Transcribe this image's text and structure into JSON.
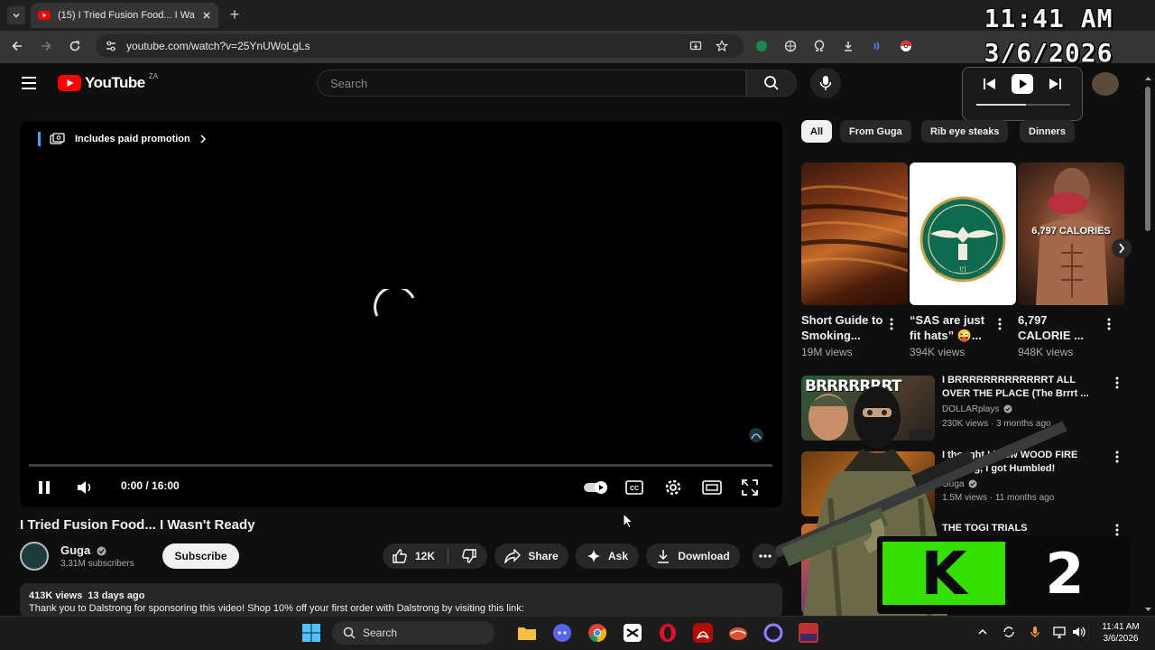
{
  "browser": {
    "tab_title": "(15) I Tried Fusion Food... I Wasn't Ready",
    "url": "youtube.com/watch?v=25YnUWoLgLs",
    "new_tab_symbol": "+"
  },
  "overlay_clock": {
    "time": "11:41 AM",
    "date": "3/6/2026"
  },
  "youtube": {
    "logo_text": "YouTube",
    "region": "ZA",
    "search_placeholder": "Search"
  },
  "player": {
    "paid_promotion": "Includes paid promotion",
    "time_display": "0:00 / 16:00",
    "progress_fraction": 0.0
  },
  "video": {
    "title": "I Tried Fusion Food... I Wasn't Ready",
    "channel": "Guga",
    "subscribers": "3.31M subscribers",
    "subscribe_label": "Subscribe",
    "likes": "12K",
    "share_label": "Share",
    "ask_label": "Ask",
    "download_label": "Download",
    "stats": "413K views  13 days ago",
    "description": "Thank you to Dalstrong for sponsoring this video! Shop 10% off your first order with Dalstrong by visiting this link:"
  },
  "chips": [
    "All",
    "From Guga",
    "Rib eye steaks",
    "Dinners"
  ],
  "shorts": [
    {
      "title": "Short Guide to Smoking...",
      "views": "19M views"
    },
    {
      "title": "“SAS are just fit hats” 😜...",
      "views": "394K views",
      "thumb_text": "section commander"
    },
    {
      "title": "6,797 CALORIE ...",
      "views": "948K views",
      "thumb_text": "6,797 CALORIES"
    }
  ],
  "related": [
    {
      "title": "I BRRRRRRRRRRRRRT ALL OVER THE PLACE (The Brrrt ...",
      "channel": "DOLLARplays",
      "meta": "230K views · 3 months ago",
      "thumb_text": "BRRRRRRRT"
    },
    {
      "title": "I thought I knew WOOD FIRE cooking, I got Humbled!",
      "channel": "Guga",
      "meta": "1.5M views · 11 months ago"
    },
    {
      "title": "THE TOGI TRIALS",
      "channel": "",
      "meta": ""
    }
  ],
  "overlay_logo": {
    "text": "K",
    "number": "2"
  },
  "taskbar": {
    "search_label": "Search",
    "time": "11:41 AM",
    "date": "3/6/2026"
  },
  "colors": {
    "yt_red": "#ff0000",
    "accent_blue": "#3ea6ff",
    "k2_green": "#33e000"
  }
}
